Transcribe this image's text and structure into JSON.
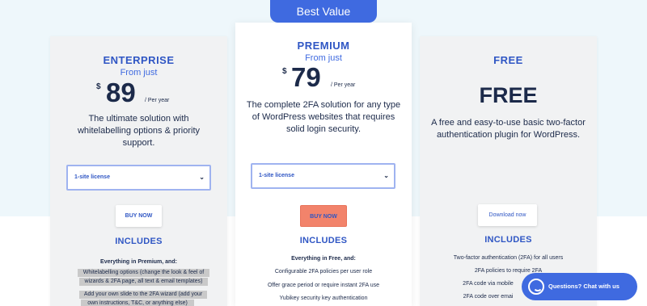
{
  "badge": "Best Value",
  "enterprise": {
    "name": "ENTERPRISE",
    "from": "From just",
    "currency": "$",
    "price": "89",
    "period": "/ Per year",
    "description": [
      "The ultimate solution with",
      "whitelabelling options & priority",
      "support."
    ],
    "license": "1-site license",
    "button": "BUY NOW",
    "includes": "INCLUDES",
    "features": [
      "Everything in Premium, and:",
      "Whitelabelling options (change the look & feel of",
      "wizards & 2FA page, all text & email templates)",
      "Add your own slide to the 2FA wizard (add your",
      "own instructions, T&C, or anything else)"
    ]
  },
  "premium": {
    "name": "PREMIUM",
    "from": "From just",
    "currency": "$",
    "price": "79",
    "period": "/ Per year",
    "description": [
      "The complete 2FA solution for any type",
      "of WordPress websites that requires",
      "solid login security."
    ],
    "license": "1-site license",
    "button": "BUY NOW",
    "includes": "INCLUDES",
    "features": [
      "Everything in Free, and:",
      "Configurable 2FA policies per user role",
      "Offer grace period or require instant 2FA use",
      "Yubikey security key authentication"
    ]
  },
  "free": {
    "name": "FREE",
    "big": "FREE",
    "description": [
      "A free and easy-to-use basic two-factor",
      "authentication plugin for WordPress."
    ],
    "button": "Download now",
    "includes": "INCLUDES",
    "features": [
      "Two-factor authentication (2FA) for all users",
      "2FA policies to require 2FA",
      "2FA code via mobile",
      "2FA code over emai"
    ]
  },
  "chat": {
    "label": "Questions? Chat with us"
  },
  "colors": {
    "accent": "#3f6ae0",
    "salmon": "#f2836b",
    "navy": "#1c2a4a"
  }
}
